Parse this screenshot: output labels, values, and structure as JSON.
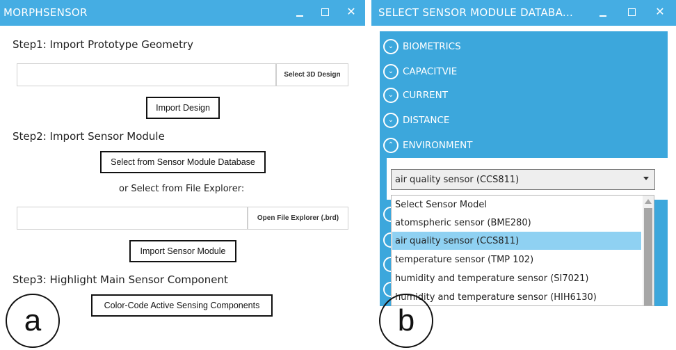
{
  "window_a": {
    "title": "MORPHSENSOR",
    "controls": {
      "minimize": "",
      "maximize": "",
      "close": "✕"
    },
    "step1_label": "Step1: Import Prototype Geometry",
    "select_3d_button": "Select 3D Design",
    "import_design_button": "Import Design",
    "step2_label": "Step2: Import Sensor Module",
    "select_database_button": "Select from Sensor Module Database",
    "or_file_explorer_label": "or Select from File Explorer:",
    "open_file_explorer_button": "Open File Explorer (.brd)",
    "import_sensor_button": "Import Sensor Module",
    "step3_label": "Step3: Highlight Main Sensor Component",
    "color_code_button": "Color-Code Active Sensing Components",
    "figure_label": "a"
  },
  "window_b": {
    "title": "SELECT SENSOR MODULE DATABA...",
    "controls": {
      "minimize": "",
      "maximize": "",
      "close": "✕"
    },
    "categories": [
      {
        "label": "BIOMETRICS",
        "icon": "chevron-down-icon",
        "glyph": "⌄"
      },
      {
        "label": "CAPACITVIE",
        "icon": "chevron-down-icon",
        "glyph": "⌄"
      },
      {
        "label": "CURRENT",
        "icon": "chevron-down-icon",
        "glyph": "⌄"
      },
      {
        "label": "DISTANCE",
        "icon": "chevron-down-icon",
        "glyph": "⌄"
      },
      {
        "label": "ENVIRONMENT",
        "icon": "chevron-up-icon",
        "glyph": "⌃"
      }
    ],
    "selected_value": "air quality sensor (CCS811)",
    "options": [
      "Select Sensor Model",
      "atomspheric sensor (BME280)",
      "air quality sensor (CCS811)",
      "temperature sensor (TMP 102)",
      "humidity and temperature sensor (SI7021)",
      "humidity and temperature sensor (HIH6130)"
    ],
    "highlighted_option_index": 2,
    "figure_label": "b"
  },
  "colors": {
    "title_bar": "#45ade3",
    "panel": "#3ca7dc",
    "highlight": "#8fd1f2"
  }
}
